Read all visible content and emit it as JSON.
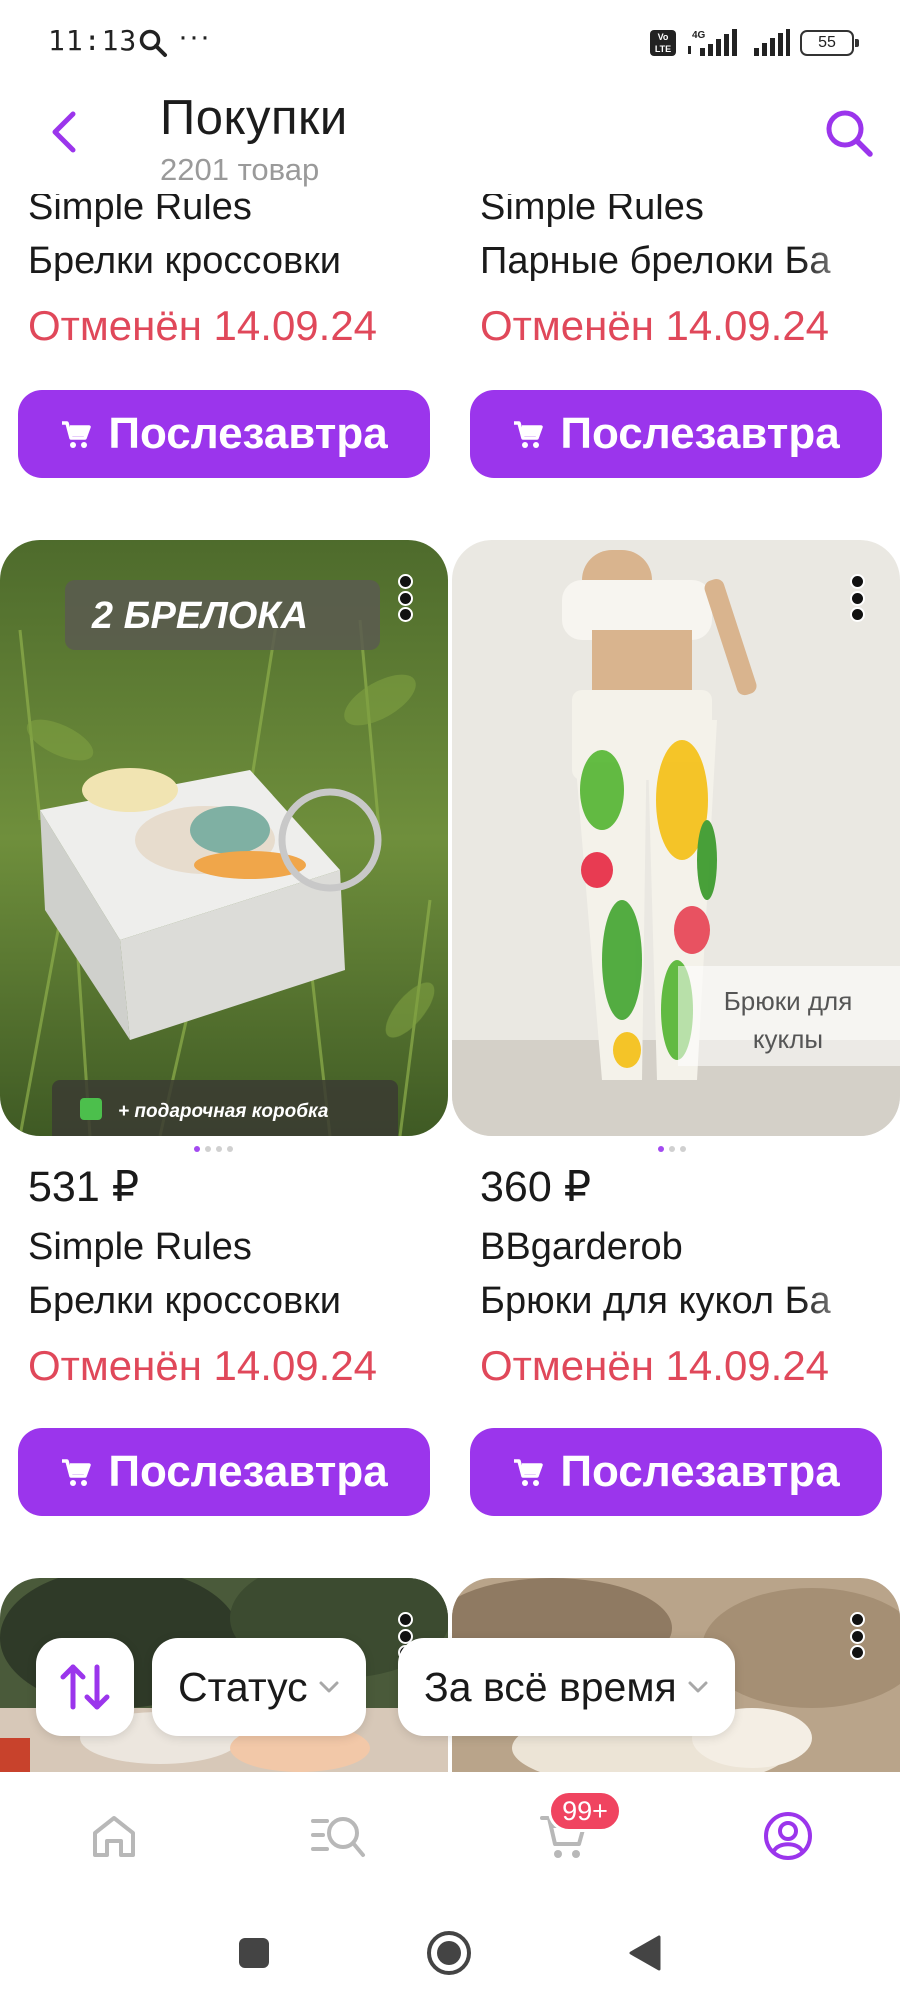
{
  "status_bar": {
    "time": "11:13",
    "dots": "···",
    "network": "4G",
    "volte": "Vo LTE",
    "battery": "55"
  },
  "header": {
    "title": "Покупки",
    "subtitle": "2201 товар"
  },
  "products_top": [
    {
      "brand": "Simple Rules",
      "name": "Брелки кроссовки",
      "status": "Отменён 14.09.24",
      "button": "Послезавтра"
    },
    {
      "brand": "Simple Rules",
      "name": "Парные брелоки Ба",
      "status": "Отменён 14.09.24",
      "button": "Послезавтра"
    }
  ],
  "products_middle": [
    {
      "price": "531 ₽",
      "brand": "Simple Rules",
      "name": "Брелки кроссовки",
      "status": "Отменён 14.09.24",
      "button": "Послезавтра",
      "image_label": "2 БРЕЛОКА",
      "image_footer": "+ подарочная коробка",
      "image_pages": 4,
      "image_page_current": 1
    },
    {
      "price": "360 ₽",
      "brand": "BBgarderob",
      "name": "Брюки для кукол Ба",
      "status": "Отменён 14.09.24",
      "button": "Послезавтра",
      "image_label": "Брюки для куклы",
      "image_pages": 3,
      "image_page_current": 1
    }
  ],
  "filters": {
    "status_label": "Статус",
    "period_label": "За всё время"
  },
  "bottom_nav": {
    "cart_badge": "99+",
    "items": [
      "home-icon",
      "catalog-icon",
      "cart-icon",
      "profile-icon"
    ]
  },
  "colors": {
    "accent": "#9b35ec",
    "status_red": "#e0485a",
    "badge_red": "#f04460"
  }
}
